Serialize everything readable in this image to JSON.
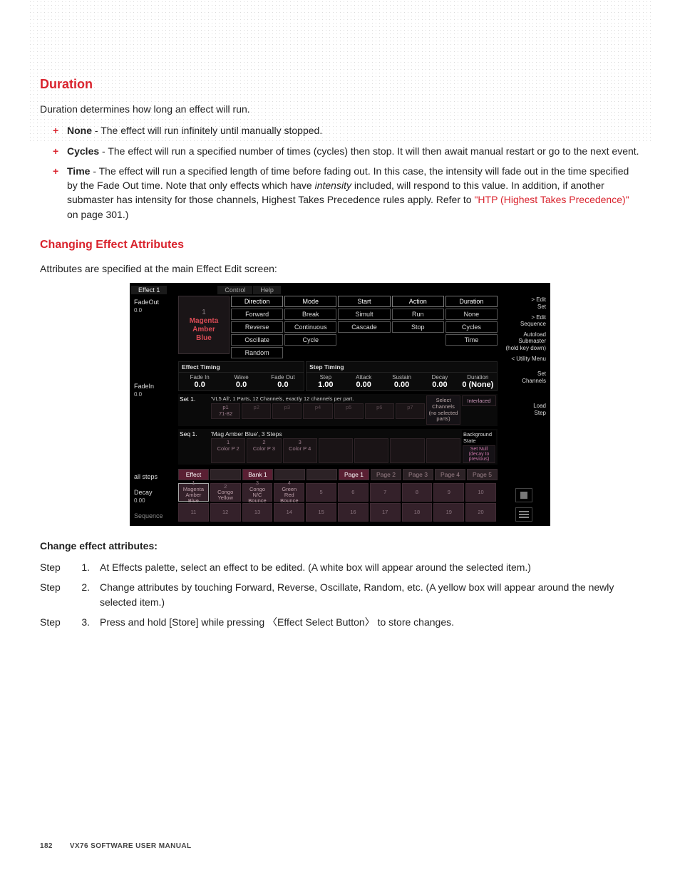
{
  "section1": {
    "title": "Duration",
    "intro": "Duration determines how long an effect will run.",
    "items": [
      {
        "bold": "None",
        "rest": " - The effect will run infinitely until manually stopped."
      },
      {
        "bold": "Cycles",
        "rest": " - The effect will run a specified number of times (cycles) then stop. It will then await manual restart or go to the next event."
      },
      {
        "bold": "Time",
        "rest": " - The effect will run a specified length of time before fading out. In this case, the intensity will fade out in the time specified by the Fade Out time. Note that only effects which have ",
        "em": "intensity",
        "rest2": " included, will respond to this value. In addition, if another submaster has intensity for those channels, Highest Takes Precedence rules apply. Refer to ",
        "link": "\"HTP (Highest Takes Precedence)\"",
        "rest3": " on page 301.)"
      }
    ]
  },
  "section2": {
    "title": "Changing Effect Attributes",
    "intro": "Attributes are specified at the main Effect Edit screen:"
  },
  "change_heading": "Change effect attributes:",
  "steps": {
    "label": "Step",
    "rows": [
      {
        "n": "1.",
        "txt": "At Effects palette, select an effect to be edited. (A white box will appear around the selected item.)"
      },
      {
        "n": "2.",
        "txt": "Change attributes by touching Forward, Reverse, Oscillate, Random, etc. (A yellow box will appear around the newly selected item.)"
      },
      {
        "n": "3.",
        "txt": "Press and hold [Store] while pressing 〈Effect Select Button〉 to store changes."
      }
    ]
  },
  "footer": {
    "page": "182",
    "manual": "VX76 SOFTWARE USER MANUAL"
  },
  "shot": {
    "title_tabs": [
      "Effect 1",
      "Control",
      "Help"
    ],
    "left": {
      "fadeout": {
        "label": "FadeOut",
        "val": "0.0"
      },
      "fadein": {
        "label": "FadeIn",
        "val": "0.0"
      },
      "allsteps": {
        "label": "all steps"
      },
      "decay": {
        "label": "Decay",
        "val": "0.00"
      },
      "sequence": {
        "label": "Sequence"
      }
    },
    "slot": {
      "num": "1",
      "l1": "Magenta",
      "l2": "Amber",
      "l3": "Blue"
    },
    "attr": {
      "cols": [
        {
          "head": "Direction",
          "opts": [
            "Forward",
            "Reverse",
            "Oscillate",
            "Random"
          ]
        },
        {
          "head": "Mode",
          "opts": [
            "Break",
            "Continuous",
            "Cycle"
          ]
        },
        {
          "head": "Start",
          "opts": [
            "Simult",
            "Cascade"
          ]
        },
        {
          "head": "Action",
          "opts": [
            "Run",
            "Stop"
          ]
        },
        {
          "head": "Duration",
          "opts": [
            "None",
            "Cycles",
            "Time"
          ]
        }
      ]
    },
    "effect_timing": {
      "title": "Effect Timing",
      "cells": [
        {
          "l": "Fade In",
          "v": "0.0"
        },
        {
          "l": "Wave",
          "v": "0.0"
        },
        {
          "l": "Fade Out",
          "v": "0.0"
        }
      ]
    },
    "step_timing": {
      "title": "Step Timing",
      "cells": [
        {
          "l": "Step",
          "v": "1.00"
        },
        {
          "l": "Attack",
          "v": "0.00"
        },
        {
          "l": "Sustain",
          "v": "0.00"
        },
        {
          "l": "Decay",
          "v": "0.00"
        },
        {
          "l": "Duration",
          "v": "0 (None)"
        }
      ]
    },
    "set": {
      "head": "Set 1.",
      "desc": "'VL5 All', 1 Parts, 12 Channels, exactly 12 channels per part.",
      "parts": [
        "p1\n71-82",
        "p2",
        "p3",
        "p4",
        "p5",
        "p6",
        "p7"
      ],
      "side1": "Select\nChannels\n(no selected\nparts)",
      "side2": "Interlaced"
    },
    "seq": {
      "head": "Seq 1.",
      "desc": "'Mag Amber Blue', 3 Steps",
      "steps": [
        "1\nColor P 2",
        "2\nColor P 3",
        "3\nColor P 4",
        "",
        "",
        "",
        ""
      ],
      "bg_head": "Background State",
      "bg_pill": "Set Null\n(decay to\nprevious)"
    },
    "pager": {
      "left": [
        "Effect",
        ""
      ],
      "bank": "Bank 1",
      "spacer": [
        "",
        ""
      ],
      "pages": [
        "Page 1",
        "Page 2",
        "Page 3",
        "Page 4",
        "Page 5"
      ]
    },
    "palette": [
      {
        "n": "1",
        "t": "Magenta\nAmber\nBlue",
        "sel": true
      },
      {
        "n": "2",
        "t": "Congo\nYellow"
      },
      {
        "n": "3",
        "t": "Congo\nN/C\nBounce"
      },
      {
        "n": "4",
        "t": "Green\nRed\nBounce"
      },
      {
        "n": "5",
        "t": ""
      },
      {
        "n": "6",
        "t": ""
      },
      {
        "n": "7",
        "t": ""
      },
      {
        "n": "8",
        "t": ""
      },
      {
        "n": "9",
        "t": ""
      },
      {
        "n": "10",
        "t": ""
      },
      {
        "n": "11",
        "t": ""
      },
      {
        "n": "12",
        "t": ""
      },
      {
        "n": "13",
        "t": ""
      },
      {
        "n": "14",
        "t": ""
      },
      {
        "n": "15",
        "t": ""
      },
      {
        "n": "16",
        "t": ""
      },
      {
        "n": "17",
        "t": ""
      },
      {
        "n": "18",
        "t": ""
      },
      {
        "n": "19",
        "t": ""
      },
      {
        "n": "20",
        "t": ""
      }
    ],
    "right": [
      "> Edit\nSet",
      "> Edit\nSequence",
      "Autoload\nSubmaster\n(hold key down)",
      "< Utility Menu",
      "Set\nChannels",
      "Load\nStep"
    ]
  }
}
